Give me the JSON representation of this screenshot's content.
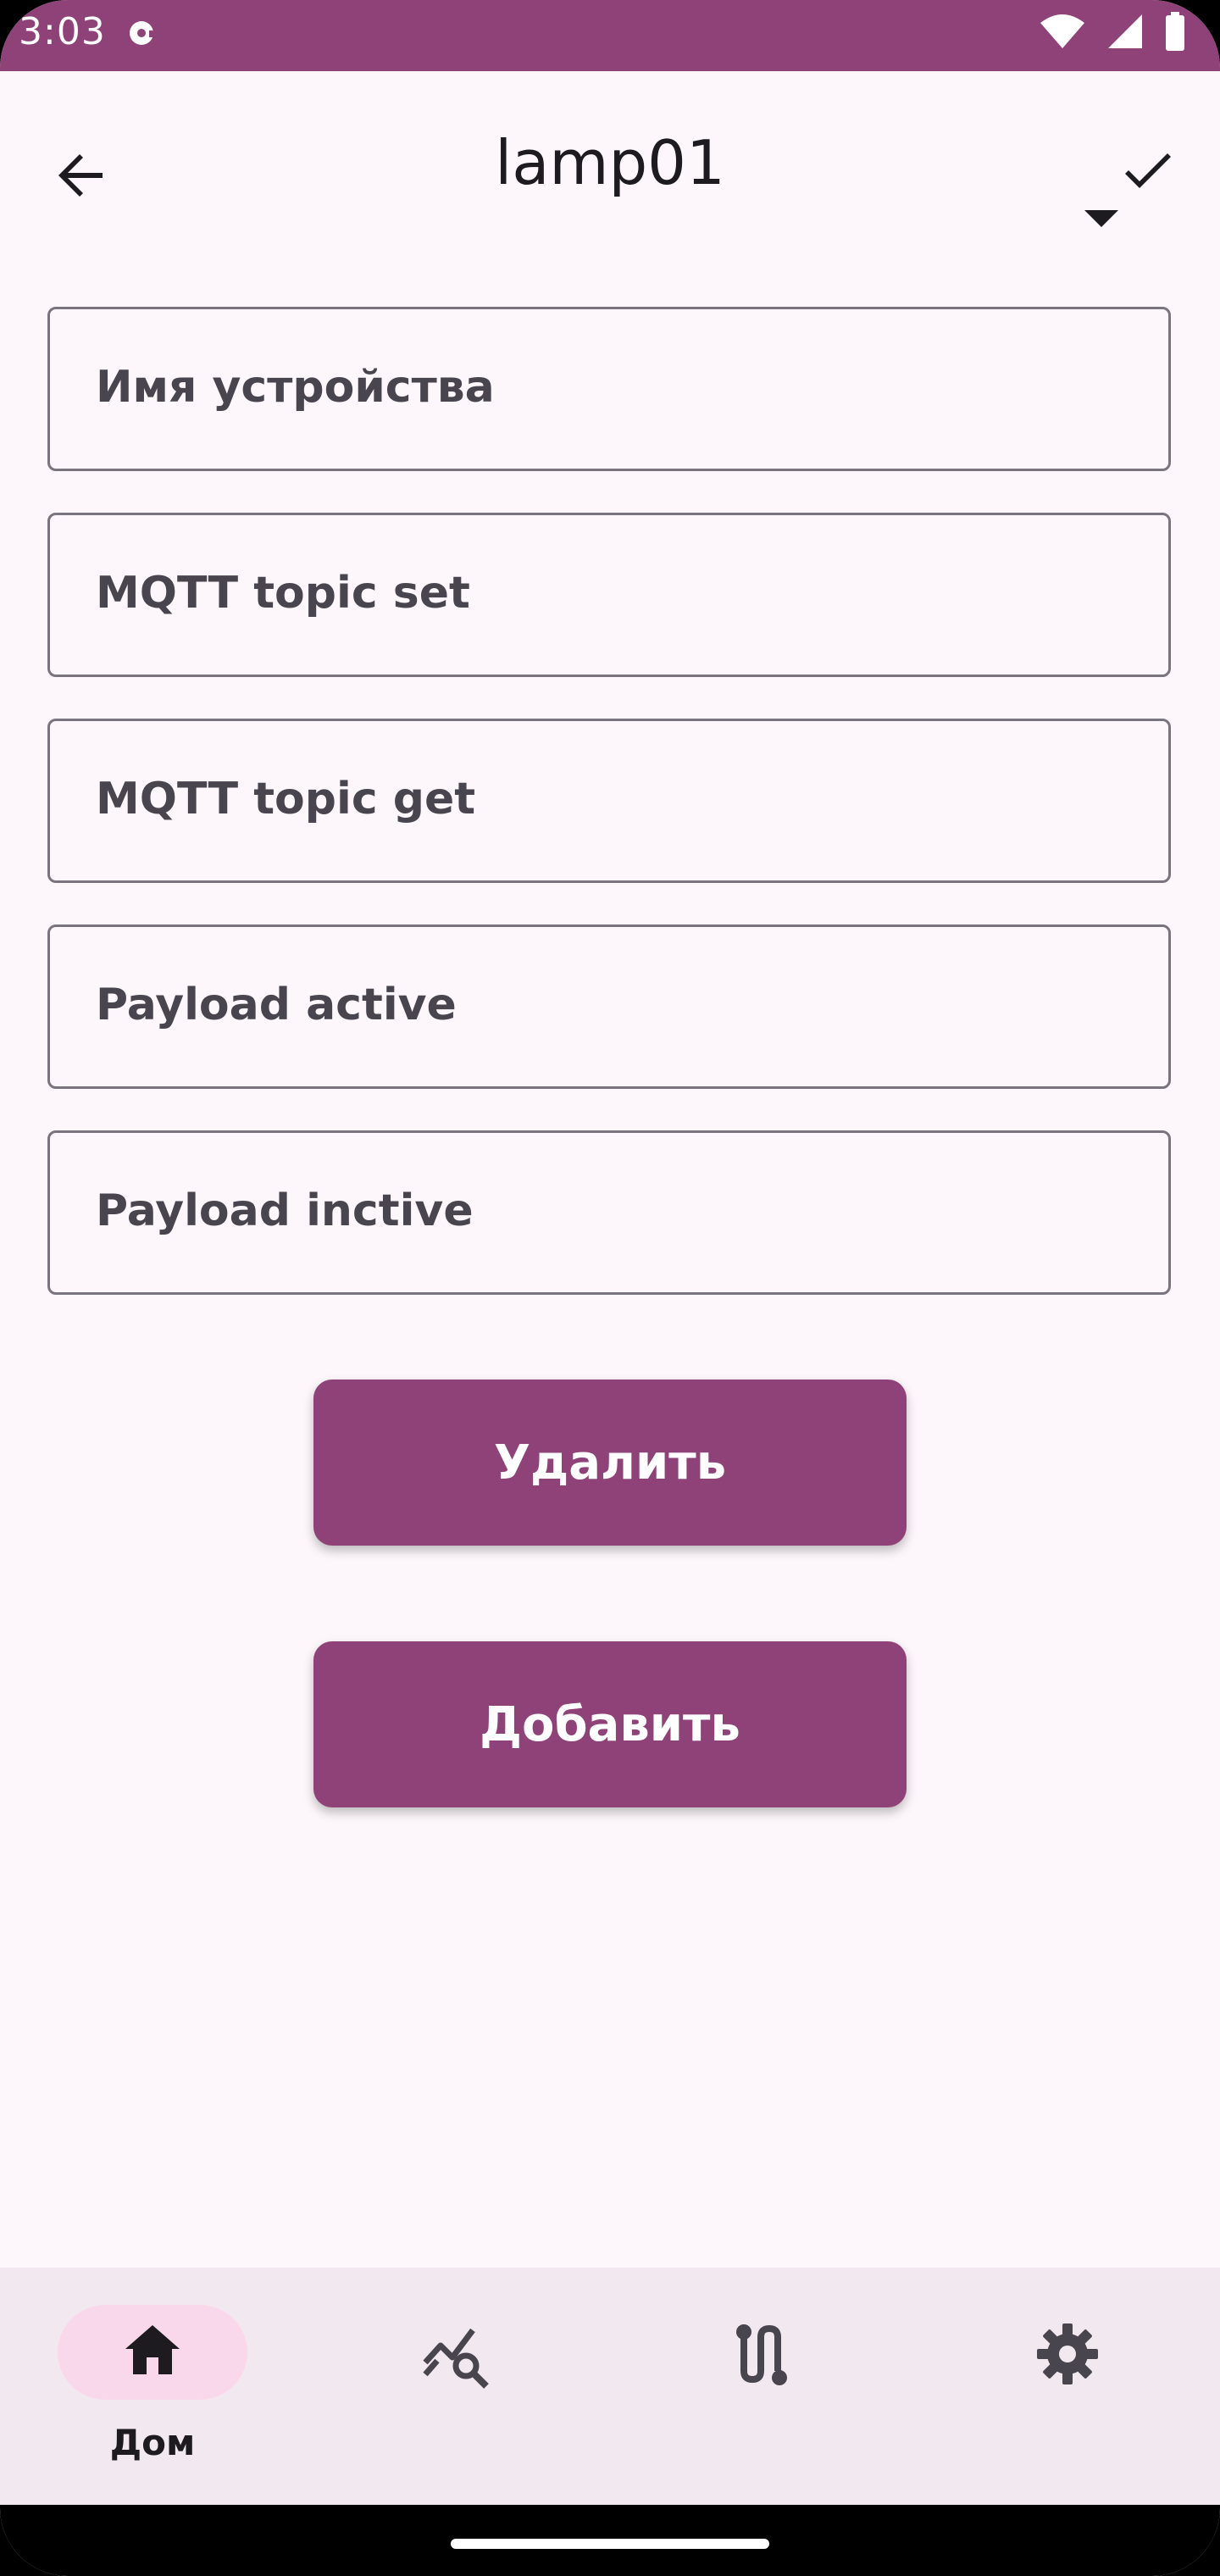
{
  "status_bar": {
    "time": "3:03",
    "background": "#8E4277",
    "icons": [
      "media-icon",
      "wifi-icon",
      "signal-icon",
      "battery-icon"
    ]
  },
  "app_bar": {
    "title": "lamp01",
    "back_icon": "arrow-back-icon",
    "confirm_icon": "check-icon",
    "dropdown_icon": "dropdown-caret-icon"
  },
  "form": {
    "fields": [
      {
        "label": "Имя устройства",
        "value": ""
      },
      {
        "label": "MQTT topic set",
        "value": ""
      },
      {
        "label": "MQTT topic get",
        "value": ""
      },
      {
        "label": "Payload active",
        "value": ""
      },
      {
        "label": "Payload inctive",
        "value": ""
      }
    ]
  },
  "actions": {
    "delete_label": "Удалить",
    "add_label": "Добавить",
    "button_color": "#8E4277"
  },
  "bottom_nav": {
    "items": [
      {
        "label": "Дом",
        "icon": "home-icon",
        "selected": true
      },
      {
        "label": "",
        "icon": "chart-search-icon",
        "selected": false
      },
      {
        "label": "",
        "icon": "route-icon",
        "selected": false
      },
      {
        "label": "",
        "icon": "gear-icon",
        "selected": false
      }
    ],
    "selected_pill_color": "#FAD8EC"
  }
}
